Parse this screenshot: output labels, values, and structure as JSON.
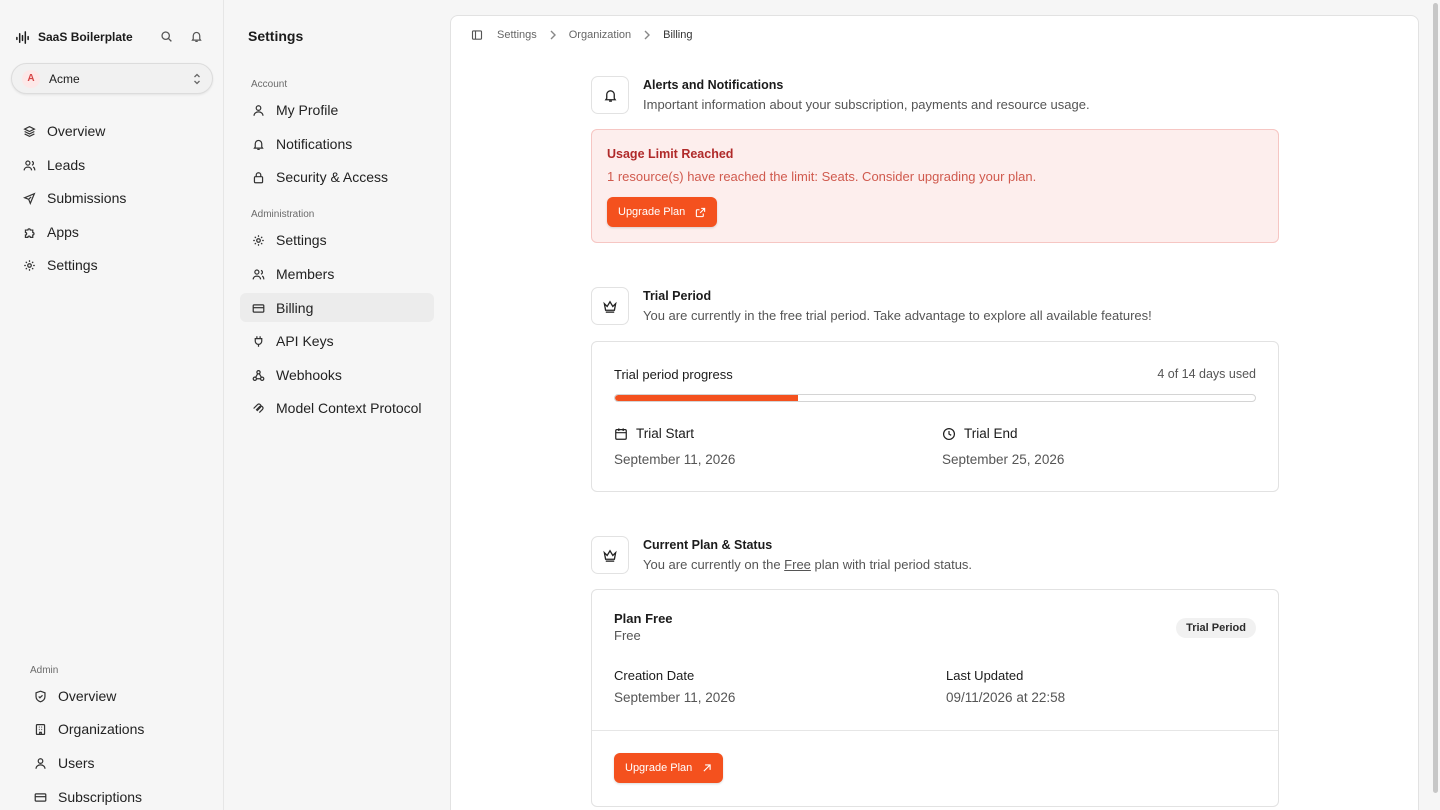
{
  "app": {
    "name": "SaaS Boilerplate"
  },
  "org": {
    "avatar_letter": "A",
    "name": "Acme"
  },
  "sidebar": {
    "main_items": [
      {
        "label": "Overview",
        "icon": "layers-icon"
      },
      {
        "label": "Leads",
        "icon": "users-icon"
      },
      {
        "label": "Submissions",
        "icon": "send-icon"
      },
      {
        "label": "Apps",
        "icon": "puzzle-icon"
      },
      {
        "label": "Settings",
        "icon": "gear-icon"
      }
    ],
    "admin_label": "Admin",
    "admin_items": [
      {
        "label": "Overview",
        "icon": "shield-icon"
      },
      {
        "label": "Organizations",
        "icon": "building-icon"
      },
      {
        "label": "Users",
        "icon": "user-icon"
      },
      {
        "label": "Subscriptions",
        "icon": "card-icon"
      }
    ]
  },
  "settings_nav": {
    "title": "Settings",
    "account_label": "Account",
    "account_items": [
      {
        "label": "My Profile",
        "icon": "user-icon"
      },
      {
        "label": "Notifications",
        "icon": "bell-icon"
      },
      {
        "label": "Security & Access",
        "icon": "lock-icon"
      }
    ],
    "admin_label": "Administration",
    "admin_items": [
      {
        "label": "Settings",
        "icon": "gear-icon"
      },
      {
        "label": "Members",
        "icon": "users-icon"
      },
      {
        "label": "Billing",
        "icon": "card-icon",
        "active": true
      },
      {
        "label": "API Keys",
        "icon": "plug-icon"
      },
      {
        "label": "Webhooks",
        "icon": "webhook-icon"
      },
      {
        "label": "Model Context Protocol",
        "icon": "mcp-icon"
      }
    ]
  },
  "breadcrumb": [
    "Settings",
    "Organization",
    "Billing"
  ],
  "alerts": {
    "title": "Alerts and Notifications",
    "subtitle": "Important information about your subscription, payments and resource usage.",
    "box_title": "Usage Limit Reached",
    "box_message": "1 resource(s) have reached the limit: Seats. Consider upgrading your plan.",
    "button": "Upgrade Plan"
  },
  "trial": {
    "title": "Trial Period",
    "subtitle": "You are currently in the free trial period. Take advantage to explore all available features!",
    "progress_label": "Trial period progress",
    "progress_text": "4 of 14 days used",
    "days_used": 4,
    "days_total": 14,
    "start_label": "Trial Start",
    "start_date": "September 11, 2026",
    "end_label": "Trial End",
    "end_date": "September 25, 2026"
  },
  "plan": {
    "title": "Current Plan & Status",
    "subtitle_before": "You are currently on the ",
    "subtitle_plan": "Free",
    "subtitle_after": " plan with trial period status.",
    "name": "Plan Free",
    "sub": "Free",
    "badge": "Trial Period",
    "created_label": "Creation Date",
    "created_value": "September 11, 2026",
    "updated_label": "Last Updated",
    "updated_value": "09/11/2026 at 22:58",
    "button": "Upgrade Plan"
  },
  "colors": {
    "accent": "#f4511e",
    "alert_bg": "#fdeeed",
    "alert_title": "#b02a2a"
  }
}
